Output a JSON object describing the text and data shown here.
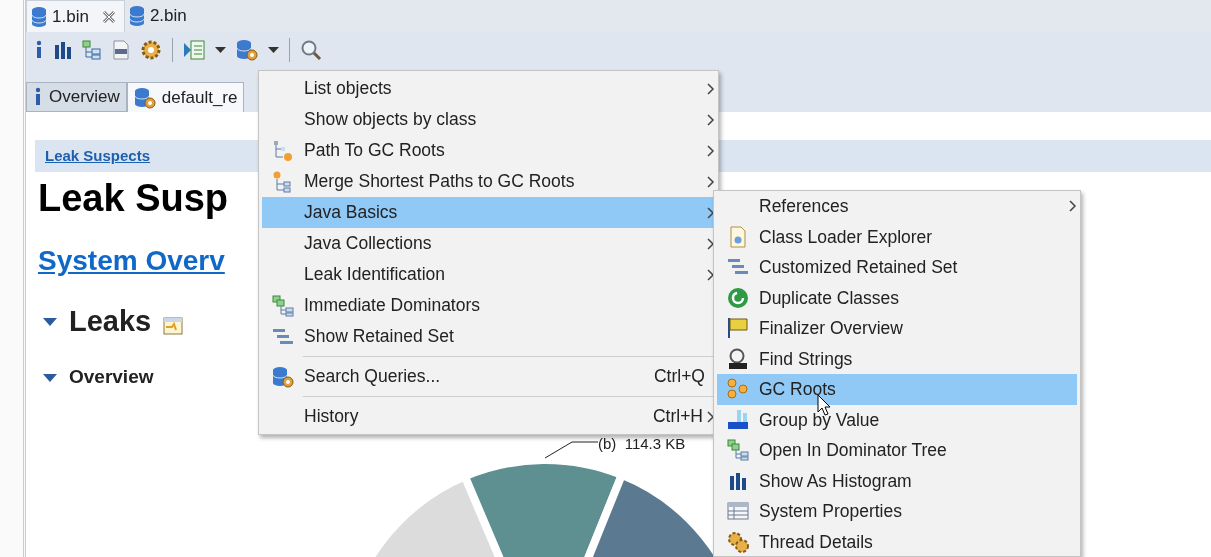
{
  "editor_tabs": [
    {
      "label": "1.bin",
      "selected": true,
      "closable": true
    },
    {
      "label": "2.bin",
      "selected": false,
      "closable": false
    }
  ],
  "view_tabs": [
    {
      "label": "Overview",
      "selected": false
    },
    {
      "label": "default_re",
      "selected": true
    }
  ],
  "report": {
    "breadcrumb": "Leak Suspects",
    "title": "Leak Susp",
    "link": "System Overv",
    "sections": [
      {
        "kind": "heading",
        "label": "Leaks",
        "expanded": true
      },
      {
        "kind": "subheading",
        "label": "Overview",
        "expanded": true
      }
    ],
    "chart_label": "(b)  114.3 KB"
  },
  "context_menu": [
    {
      "kind": "item",
      "label": "List objects",
      "submenu": true,
      "selected": false
    },
    {
      "kind": "item",
      "label": "Show objects by class",
      "submenu": true,
      "selected": false
    },
    {
      "kind": "item",
      "label": "Path To GC Roots",
      "submenu": true,
      "selected": false
    },
    {
      "kind": "item",
      "label": "Merge Shortest Paths to GC Roots",
      "submenu": true,
      "selected": false
    },
    {
      "kind": "item",
      "label": "Java Basics",
      "submenu": true,
      "selected": true
    },
    {
      "kind": "item",
      "label": "Java Collections",
      "submenu": true,
      "selected": false
    },
    {
      "kind": "item",
      "label": "Leak Identification",
      "submenu": true,
      "selected": false
    },
    {
      "kind": "item",
      "label": "Immediate Dominators",
      "submenu": false,
      "selected": false
    },
    {
      "kind": "item",
      "label": "Show Retained Set",
      "submenu": false,
      "selected": false
    },
    {
      "kind": "separator"
    },
    {
      "kind": "item",
      "label": "Search Queries...",
      "shortcut": "Ctrl+Q",
      "submenu": false,
      "selected": false
    },
    {
      "kind": "separator"
    },
    {
      "kind": "item",
      "label": "History",
      "shortcut": "Ctrl+H",
      "submenu": true,
      "selected": false
    }
  ],
  "submenu": [
    {
      "label": "References",
      "submenu": true,
      "selected": false
    },
    {
      "label": "Class Loader Explorer",
      "submenu": false,
      "selected": false
    },
    {
      "label": "Customized Retained Set",
      "submenu": false,
      "selected": false
    },
    {
      "label": "Duplicate Classes",
      "submenu": false,
      "selected": false
    },
    {
      "label": "Finalizer Overview",
      "submenu": false,
      "selected": false
    },
    {
      "label": "Find Strings",
      "submenu": false,
      "selected": false
    },
    {
      "label": "GC Roots",
      "submenu": false,
      "selected": true
    },
    {
      "label": "Group by Value",
      "submenu": false,
      "selected": false
    },
    {
      "label": "Open In Dominator Tree",
      "submenu": false,
      "selected": false
    },
    {
      "label": "Show As Histogram",
      "submenu": false,
      "selected": false
    },
    {
      "label": "System Properties",
      "submenu": false,
      "selected": false
    },
    {
      "label": "Thread Details",
      "submenu": false,
      "selected": false
    }
  ]
}
